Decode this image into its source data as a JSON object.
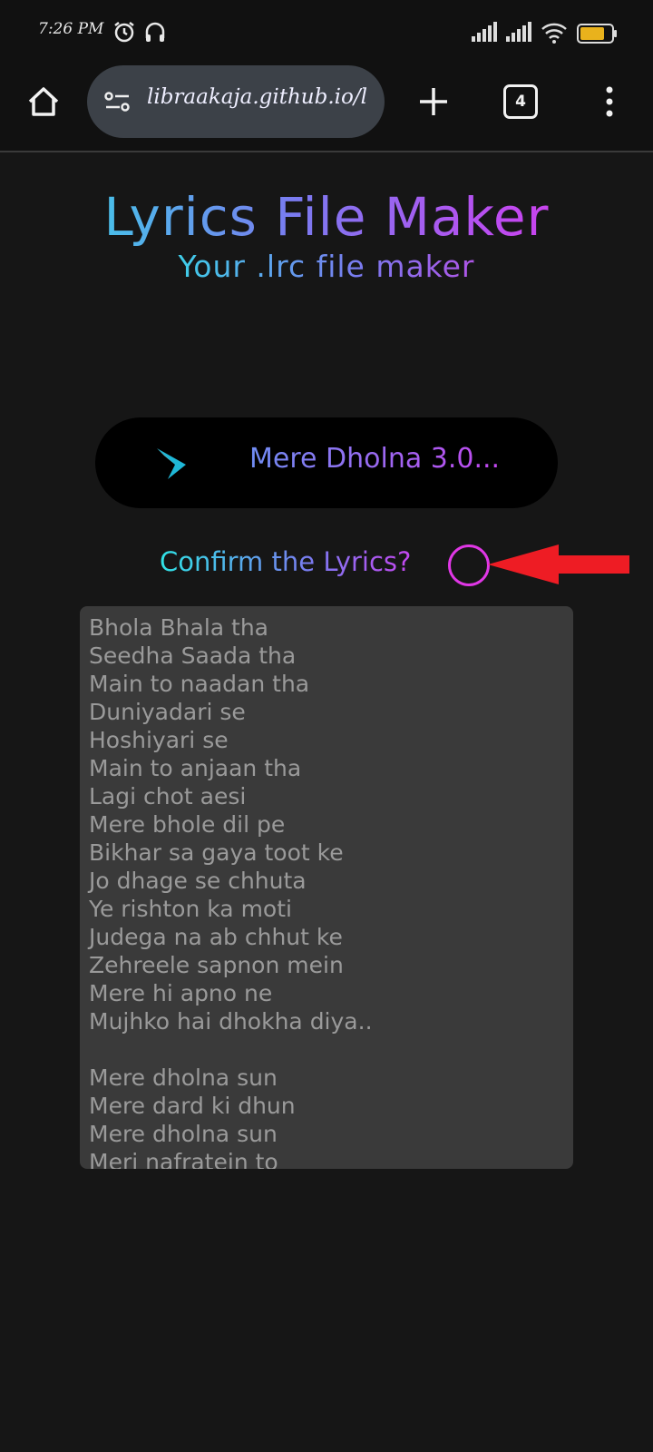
{
  "status_bar": {
    "time": "7:26 PM",
    "icons": [
      "alarm-icon",
      "headphones-icon",
      "signal-icon",
      "signal-icon",
      "wifi-icon",
      "battery-icon"
    ],
    "battery_level": "69"
  },
  "browser": {
    "url": "libraakaja.github.io/l",
    "tab_count": "4",
    "icons": [
      "home-icon",
      "site-settings-icon",
      "new-tab-icon",
      "tab-switcher-icon",
      "more-options-icon"
    ]
  },
  "header": {
    "title": "Lyrics File Maker",
    "subtitle": "Your .lrc file maker"
  },
  "player": {
    "song_title": "Mere Dholna 3.0...",
    "logo_icon": "music-logo-icon"
  },
  "confirm": {
    "label": "Confirm the Lyrics?"
  },
  "lyrics": {
    "text": "Bhola Bhala tha\nSeedha Saada tha\nMain to naadan tha\nDuniyadari se\nHoshiyari se\nMain to anjaan tha\nLagi chot aesi\nMere bhole dil pe\nBikhar sa gaya toot ke\nJo dhage se chhuta\nYe rishton ka moti\nJudega na ab chhut ke\nZehreele sapnon mein\nMere hi apno ne\nMujhko hai dhokha diya..\n\nMere dholna sun\nMere dard ki dhun\nMere dholna sun\nMeri nafratein to"
  },
  "colors": {
    "background": "#161616",
    "accent_cyan": "#2fe3e6",
    "accent_purple": "#c447f0",
    "confirm_circle": "#e037e6",
    "annotation_arrow": "#ee1c24"
  }
}
